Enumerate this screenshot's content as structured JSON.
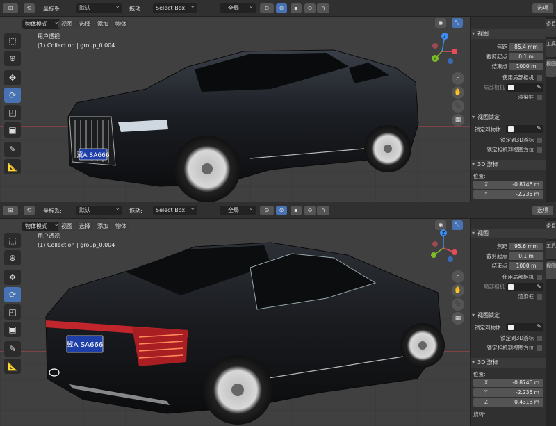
{
  "header": {
    "coordinate_label": "坐标系:",
    "coordinate_value": "默认",
    "drag_label": "拖动:",
    "drag_value": "Select Box",
    "transform_value": "全局",
    "options_label": "选项"
  },
  "subheader": {
    "mode_value": "物体模式",
    "menus": [
      "视图",
      "选择",
      "添加",
      "物体"
    ]
  },
  "top_view": {
    "perspective_label": "用户透视",
    "collection_label": "(1) Collection | group_0.004",
    "plate_text": "冀A SA666",
    "sidebar": {
      "view_panel_title": "视图",
      "focal_label": "焦距",
      "focal_value": "85.4 mm",
      "clip_start_label": "截剪起点",
      "clip_start_value": "0.1 m",
      "clip_end_label": "结束点",
      "clip_end_value": "1000 m",
      "local_camera_label": "使用局部相机",
      "camera_field_label": "局部相机",
      "render_region_label": "渲染框",
      "view_lock_title": "视图锁定",
      "lock_object_label": "锁定到物体",
      "lock_cursor_label": "锁定到3D游标",
      "lock_camera_label": "锁定相机到视图方位",
      "cursor_panel_title": "3D 游标",
      "location_label": "位置:",
      "x_label": "X",
      "x_value": "-0.8746 m",
      "y_label": "Y",
      "y_value": "-2.235 m"
    }
  },
  "bottom_view": {
    "perspective_label": "用户透视",
    "collection_label": "(1) Collection | group_0.004",
    "plate_text": "冀A SA666",
    "sidebar": {
      "view_panel_title": "视图",
      "focal_label": "焦距",
      "focal_value": "95.6 mm",
      "clip_start_label": "截剪起点",
      "clip_start_value": "0.1 m",
      "clip_end_label": "结束点",
      "clip_end_value": "1000 m",
      "local_camera_label": "使用局部相机",
      "camera_field_label": "局部相机",
      "render_region_label": "渲染框",
      "view_lock_title": "视图锁定",
      "lock_object_label": "锁定到物体",
      "lock_cursor_label": "锁定到3D游标",
      "lock_camera_label": "锁定相机到视图方位",
      "cursor_panel_title": "3D 游标",
      "location_label": "位置:",
      "x_label": "X",
      "x_value": "-0.8746 m",
      "y_label": "Y",
      "y_value": "-2.235 m",
      "z_label": "Z",
      "z_value": "0.4318 m",
      "rotation_label": "旋转:"
    }
  },
  "side_tabs": [
    "条目",
    "工具",
    "视图"
  ],
  "gizmo_axes": {
    "x": "X",
    "y": "Y",
    "z": "Z"
  },
  "colors": {
    "accent": "#4772b3",
    "x_axis": "#e74c5a",
    "y_axis": "#7bbd2a",
    "z_axis": "#3d8df2",
    "viewport_bg": "#404040"
  }
}
